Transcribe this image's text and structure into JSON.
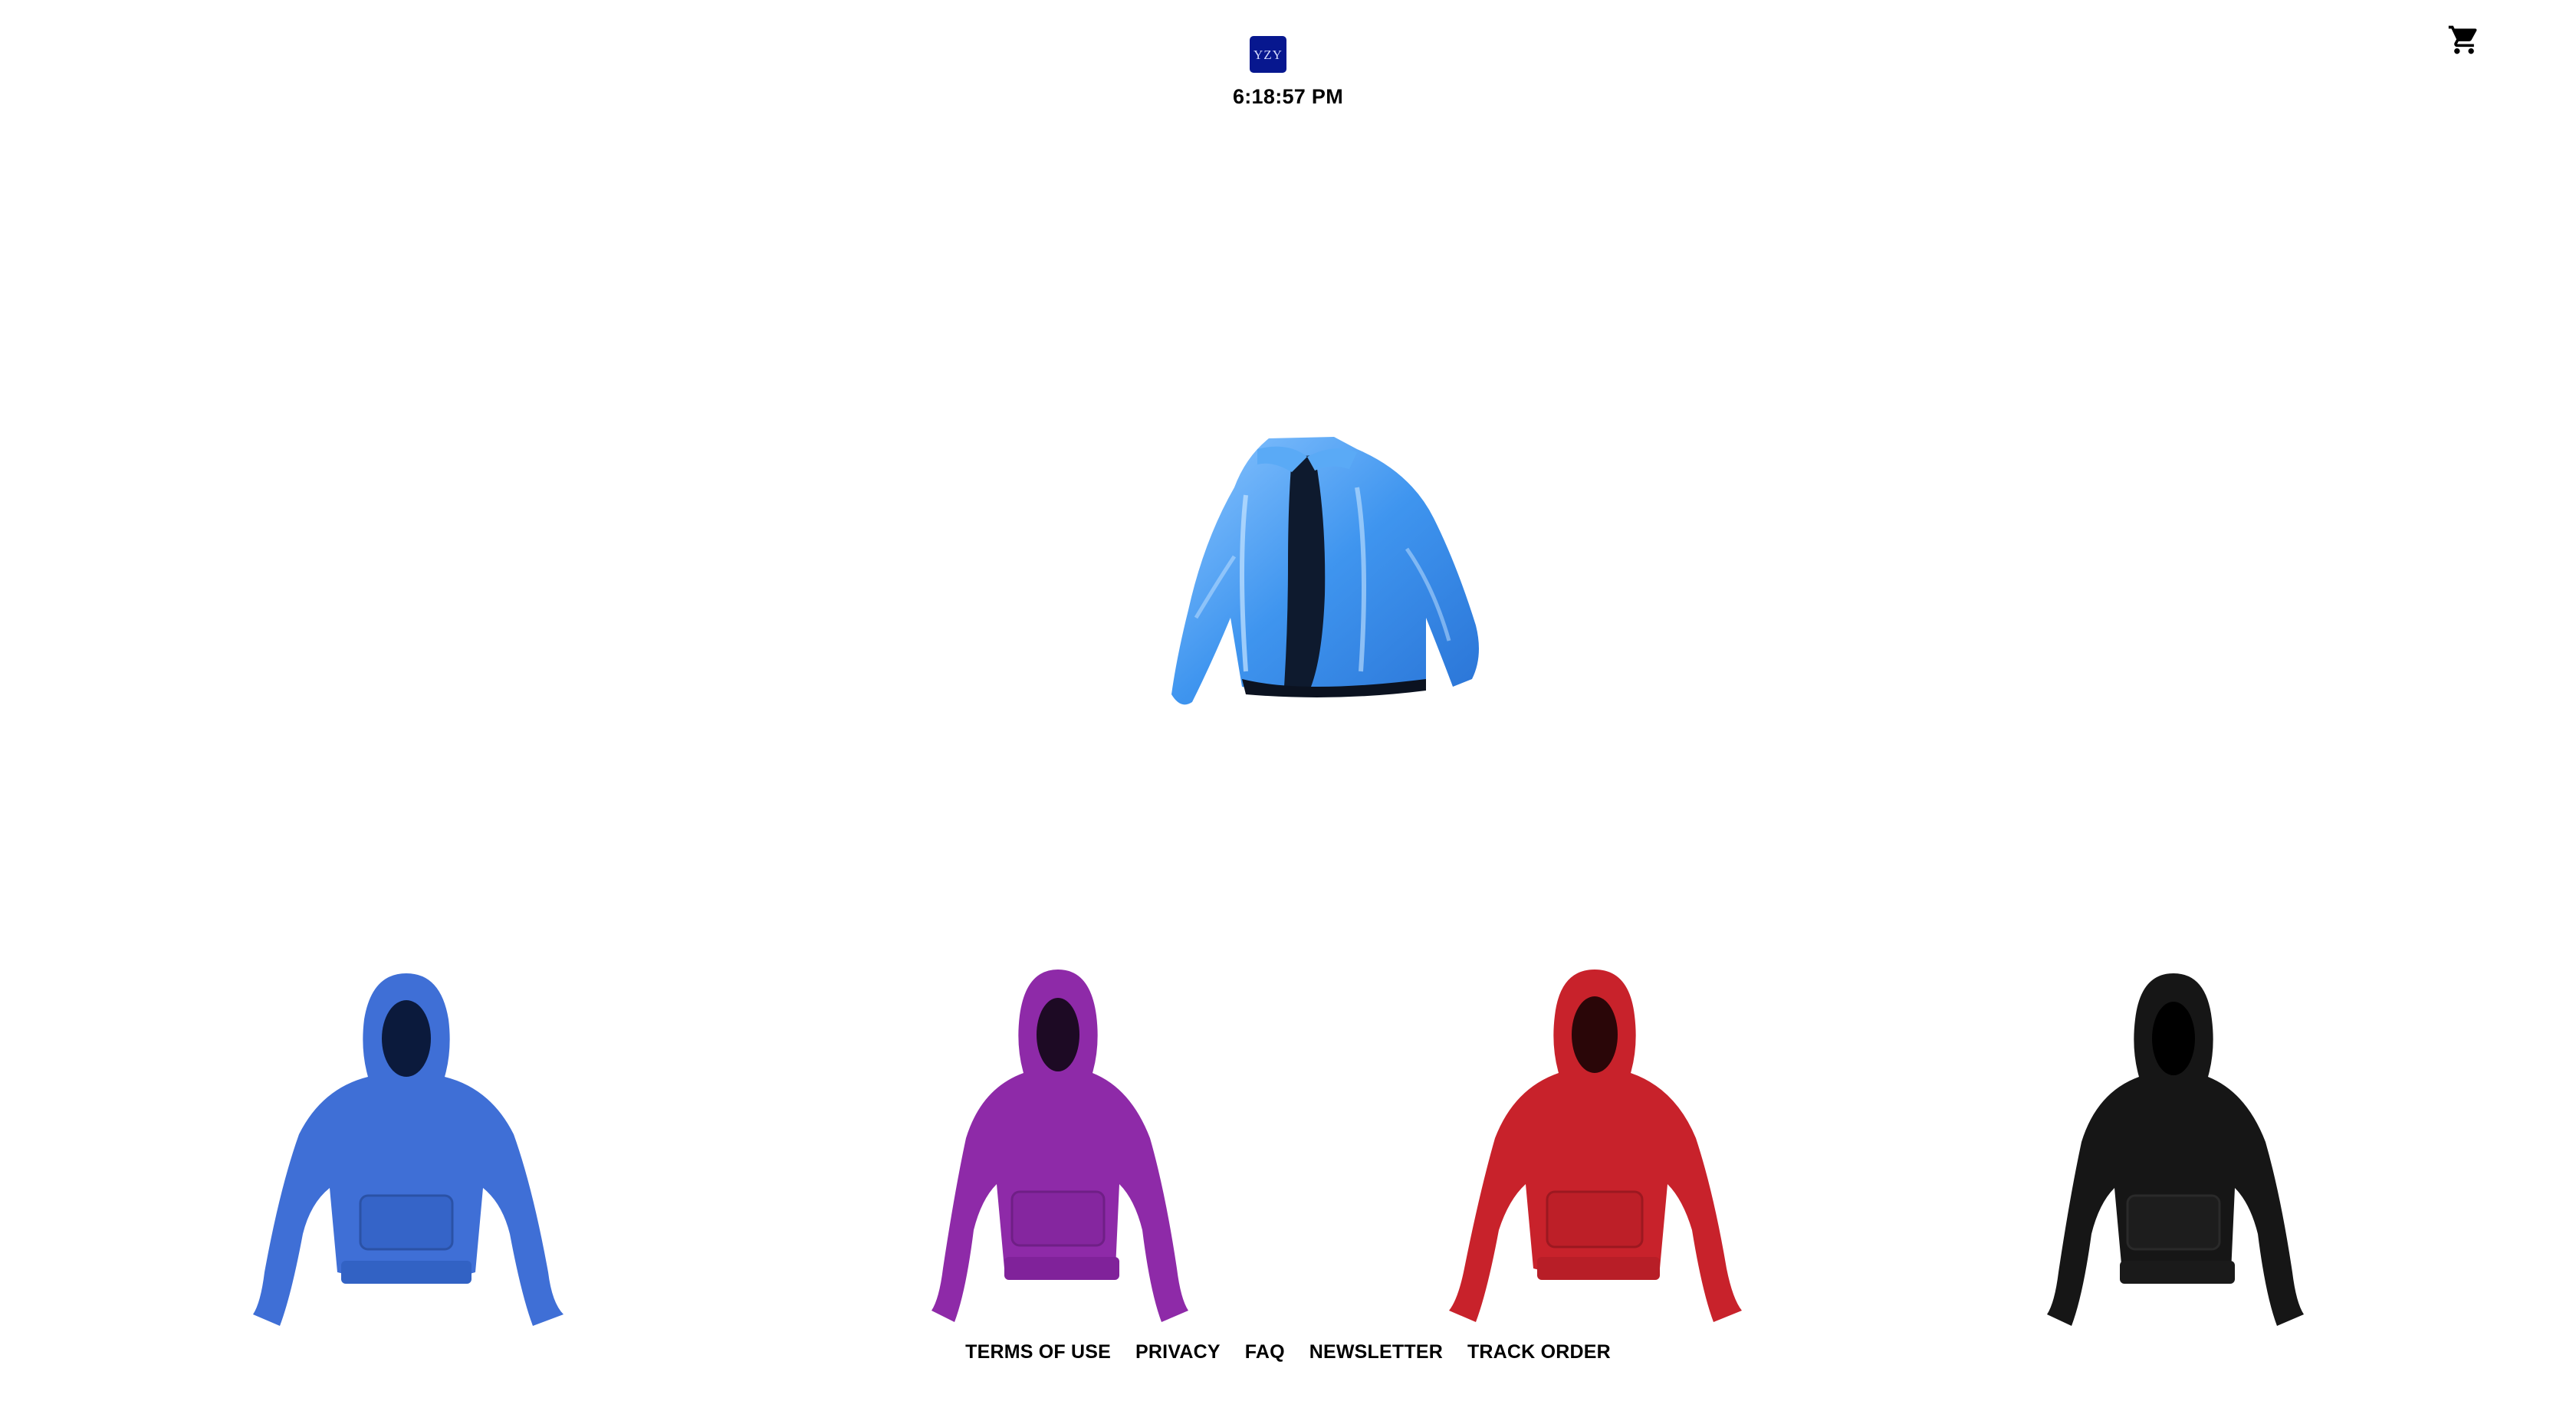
{
  "header": {
    "logo_text": "YZY",
    "clock": "6:18:57 PM",
    "cart_icon": "cart-icon"
  },
  "products": {
    "featured": {
      "name": "Blue puffer jacket",
      "color": "#4a97f2"
    },
    "hoodies": [
      {
        "name": "Blue hoodie",
        "color": "#3f6fd6"
      },
      {
        "name": "Purple hoodie",
        "color": "#8e2aa8"
      },
      {
        "name": "Red hoodie",
        "color": "#c8222b"
      },
      {
        "name": "Black hoodie",
        "color": "#161616"
      }
    ]
  },
  "footer": {
    "links": [
      "TERMS OF USE",
      "PRIVACY",
      "FAQ",
      "NEWSLETTER",
      "TRACK ORDER"
    ]
  }
}
